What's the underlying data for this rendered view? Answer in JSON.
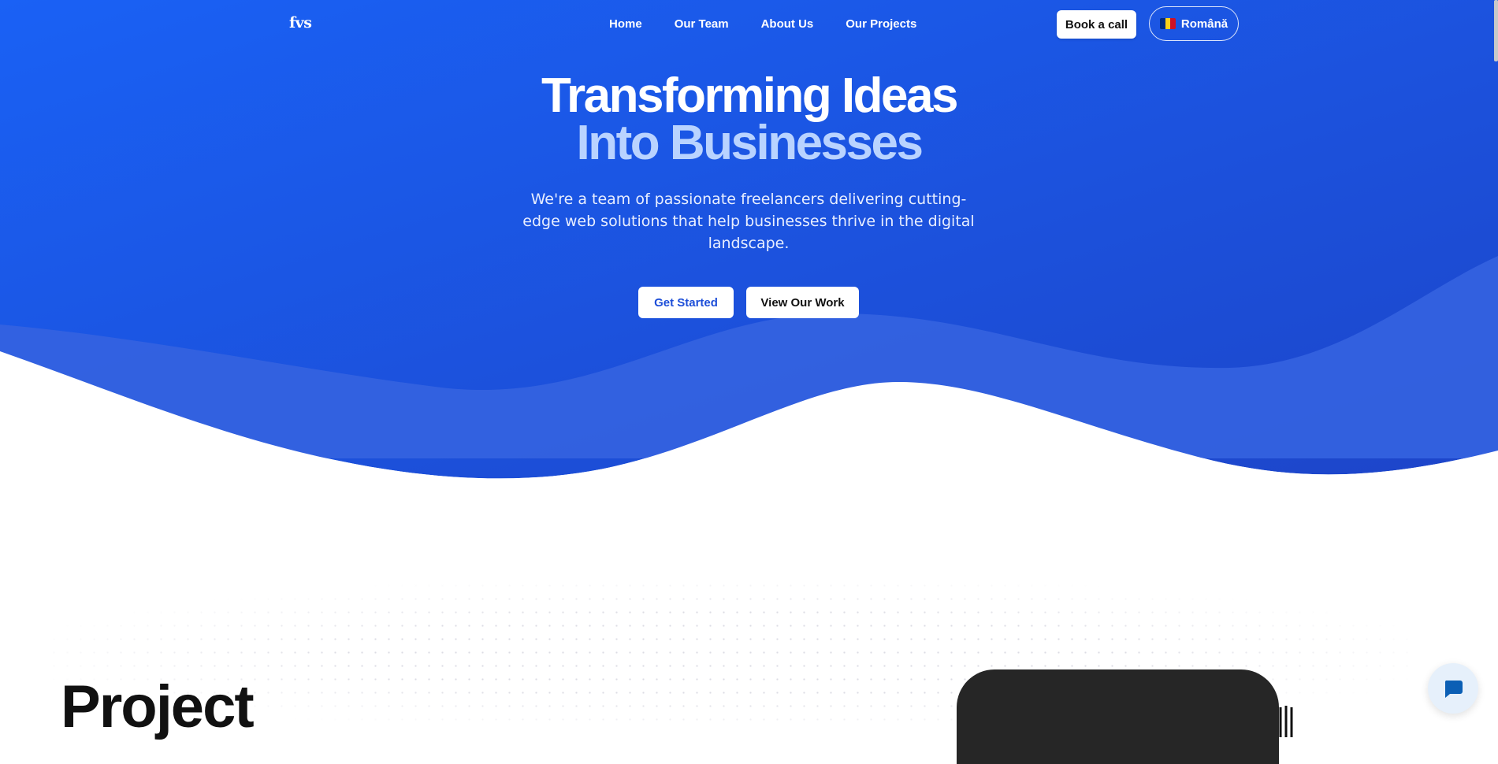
{
  "logo": "fvs",
  "nav": {
    "links": [
      "Home",
      "Our Team",
      "About Us",
      "Our Projects"
    ],
    "book_call": "Book a call",
    "language": "Română"
  },
  "hero": {
    "title_line1": "Transforming Ideas",
    "title_line2": "Into Businesses",
    "subtitle": "We're a team of passionate freelancers delivering cutting-edge web solutions that help businesses thrive in the digital landscape.",
    "cta_primary": "Get Started",
    "cta_secondary": "View Our Work"
  },
  "projects": {
    "heading": "Project"
  },
  "colors": {
    "hero_blue": "#1a5ff0",
    "hero_blue_dark": "#1d47cc",
    "wave_light": "#3563e0",
    "title_accent": "#b9d3ff"
  },
  "icons": {
    "chat": "chat-bubble-icon",
    "flag": "romania-flag-icon"
  }
}
